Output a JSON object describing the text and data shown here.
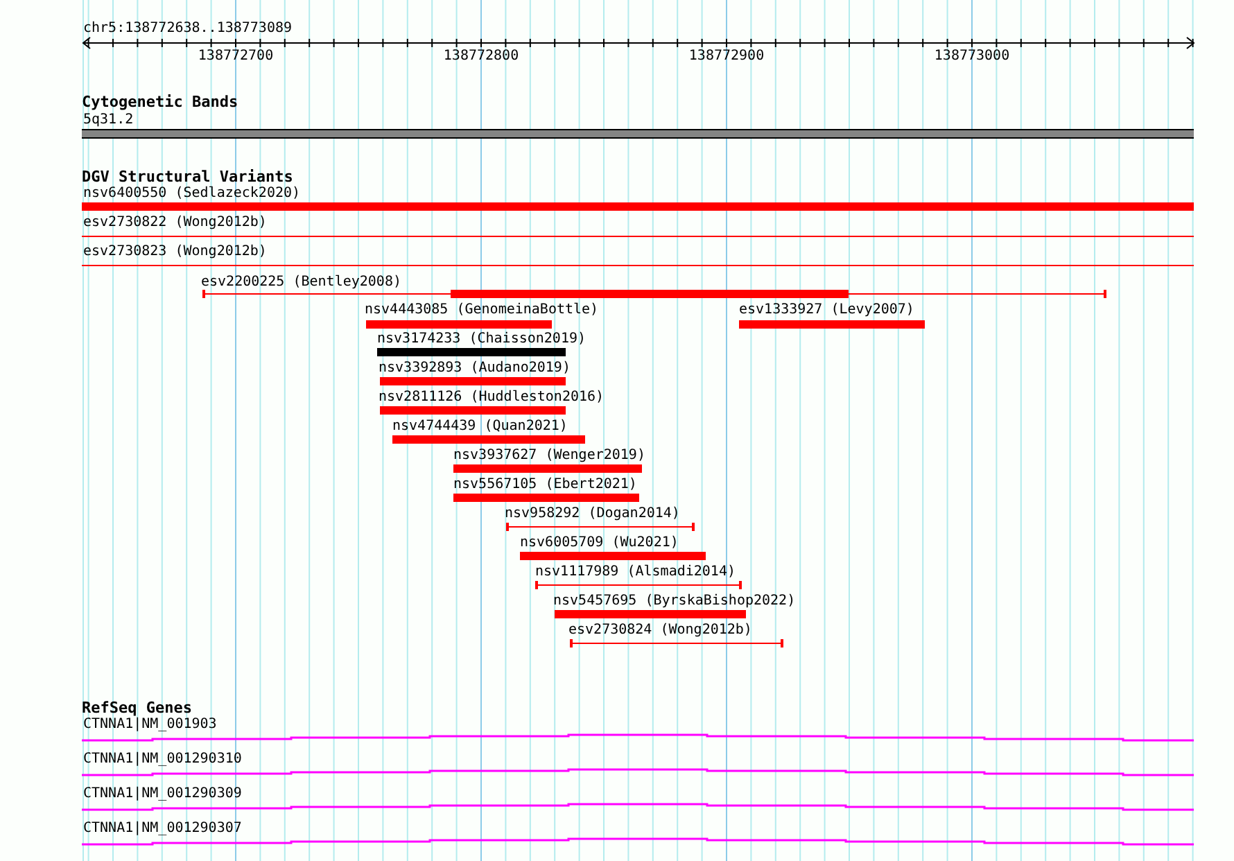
{
  "ruler": {
    "location": "chr5:138772638..138773089",
    "ticks": [
      "138772700",
      "138772800",
      "138772900",
      "138773000"
    ]
  },
  "cytobands": {
    "title": "Cytogenetic Bands",
    "band": "5q31.2"
  },
  "variants": {
    "title": "DGV Structural Variants",
    "items": [
      {
        "label": "nsv6400550 (Sedlazeck2020)",
        "kind": "bar",
        "color": "#ff0000"
      },
      {
        "label": "esv2730822 (Wong2012b)",
        "kind": "line",
        "color": "#ff0000"
      },
      {
        "label": "esv2730823 (Wong2012b)",
        "kind": "line",
        "color": "#ff0000"
      },
      {
        "label": "esv2200225 (Bentley2008)",
        "kind": "capped_bar",
        "color": "#ff0000"
      },
      {
        "label": "nsv4443085 (GenomeinaBottle)",
        "kind": "bar",
        "color": "#ff0000"
      },
      {
        "label": "esv1333927 (Levy2007)",
        "kind": "bar",
        "color": "#ff0000"
      },
      {
        "label": "nsv3174233 (Chaisson2019)",
        "kind": "bar",
        "color": "#000000"
      },
      {
        "label": "nsv3392893 (Audano2019)",
        "kind": "bar",
        "color": "#ff0000"
      },
      {
        "label": "nsv2811126 (Huddleston2016)",
        "kind": "bar",
        "color": "#ff0000"
      },
      {
        "label": "nsv4744439 (Quan2021)",
        "kind": "bar",
        "color": "#ff0000"
      },
      {
        "label": "nsv3937627 (Wenger2019)",
        "kind": "bar",
        "color": "#ff0000"
      },
      {
        "label": "nsv5567105 (Ebert2021)",
        "kind": "bar",
        "color": "#ff0000"
      },
      {
        "label": "nsv958292 (Dogan2014)",
        "kind": "capped",
        "color": "#ff0000"
      },
      {
        "label": "nsv6005709 (Wu2021)",
        "kind": "bar",
        "color": "#ff0000"
      },
      {
        "label": "nsv1117989 (Alsmadi2014)",
        "kind": "capped",
        "color": "#ff0000"
      },
      {
        "label": "nsv5457695 (ByrskaBishop2022)",
        "kind": "bar",
        "color": "#ff0000"
      },
      {
        "label": "esv2730824 (Wong2012b)",
        "kind": "capped",
        "color": "#ff0000"
      }
    ]
  },
  "genes": {
    "title": "RefSeq Genes",
    "items": [
      {
        "label": "CTNNA1|NM_001903"
      },
      {
        "label": "CTNNA1|NM_001290310"
      },
      {
        "label": "CTNNA1|NM_001290309"
      },
      {
        "label": "CTNNA1|NM_001290307"
      }
    ]
  }
}
